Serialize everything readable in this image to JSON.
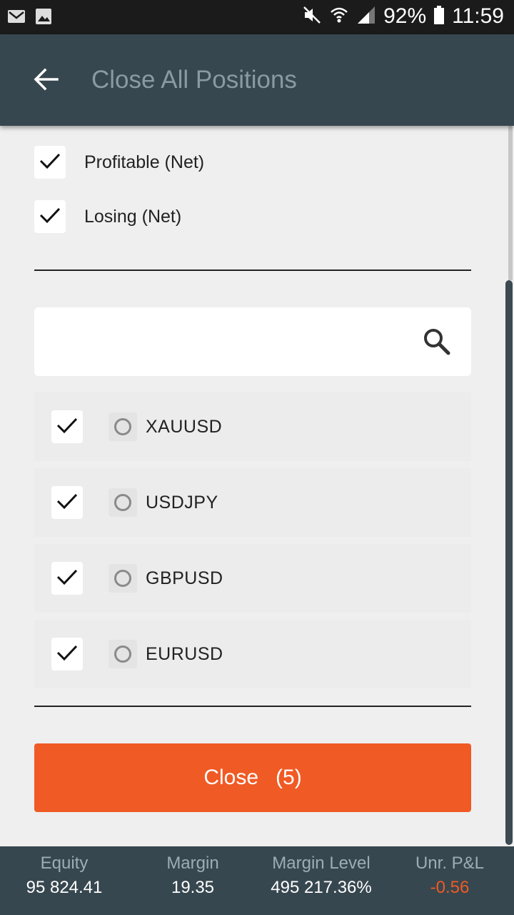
{
  "status_bar": {
    "battery": "92%",
    "time": "11:59",
    "icons": [
      "gmail-icon",
      "gallery-icon",
      "mute-icon",
      "wifi-icon",
      "signal-icon",
      "battery-icon"
    ]
  },
  "header": {
    "title": "Close All Positions",
    "back_icon": "arrow-left-icon"
  },
  "filters": [
    {
      "label": "Profitable (Net)",
      "checked": true
    },
    {
      "label": "Losing (Net)",
      "checked": true
    }
  ],
  "search": {
    "placeholder": "",
    "value": "",
    "icon": "search-icon"
  },
  "symbols": [
    {
      "name": "XAUUSD",
      "checked": true
    },
    {
      "name": "USDJPY",
      "checked": true
    },
    {
      "name": "GBPUSD",
      "checked": true
    },
    {
      "name": "EURUSD",
      "checked": true
    }
  ],
  "action": {
    "label": "Close",
    "count": "(5)"
  },
  "summary": {
    "equity_label": "Equity",
    "equity_value": "95 824.41",
    "margin_label": "Margin",
    "margin_value": "19.35",
    "margin_level_label": "Margin Level",
    "margin_level_value": "495 217.36%",
    "pnl_label": "Unr. P&L",
    "pnl_value": "-0.56"
  },
  "colors": {
    "app_bar": "#37474f",
    "accent": "#f05a24",
    "status_bar": "#1b1b1b",
    "background": "#efefef"
  }
}
